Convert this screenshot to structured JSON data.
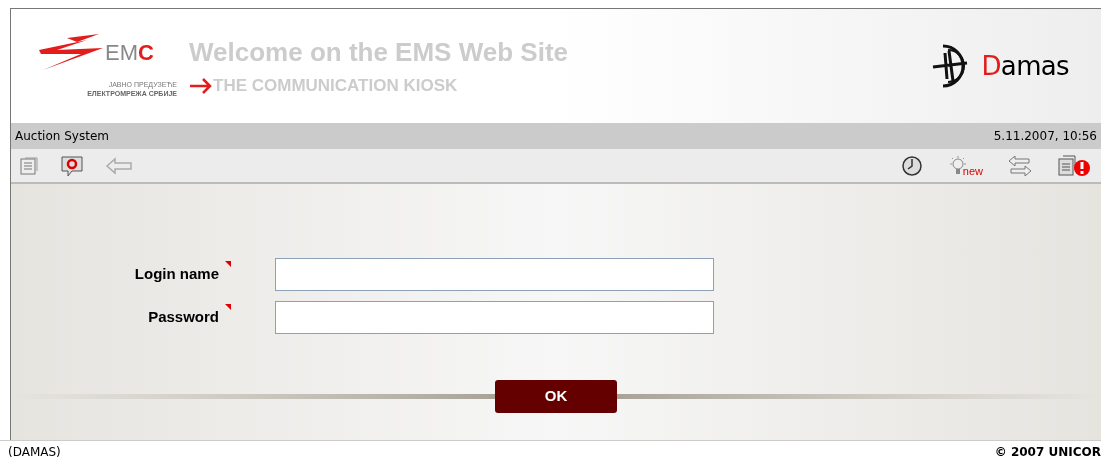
{
  "header": {
    "logo_text": "EMC",
    "logo_subtitle_1": "ЈАВНО ПРЕДУЗЕЋЕ",
    "logo_subtitle_2": "ЕЛЕКТРОМРЕЖА СРБИЈЕ",
    "title": "Welcome on the EMS Web Site",
    "subtitle": "THE COMMUNICATION KIOSK",
    "brand": "Damas"
  },
  "title_bar": {
    "system": "Auction System",
    "datetime": "5.11.2007, 10:56"
  },
  "toolbar": {
    "left": [
      {
        "kind": "document"
      },
      {
        "kind": "help"
      },
      {
        "kind": "back"
      }
    ],
    "right": [
      {
        "kind": "clock"
      },
      {
        "kind": "news",
        "badge": "new"
      },
      {
        "kind": "transfer"
      },
      {
        "kind": "alert"
      }
    ]
  },
  "form": {
    "fields": [
      {
        "label": "Login name",
        "required": true
      },
      {
        "label": "Password",
        "required": true
      }
    ],
    "submit": "OK"
  },
  "status_bar": {
    "left": "(DAMAS)",
    "right": "© 2007 UNICOR"
  }
}
